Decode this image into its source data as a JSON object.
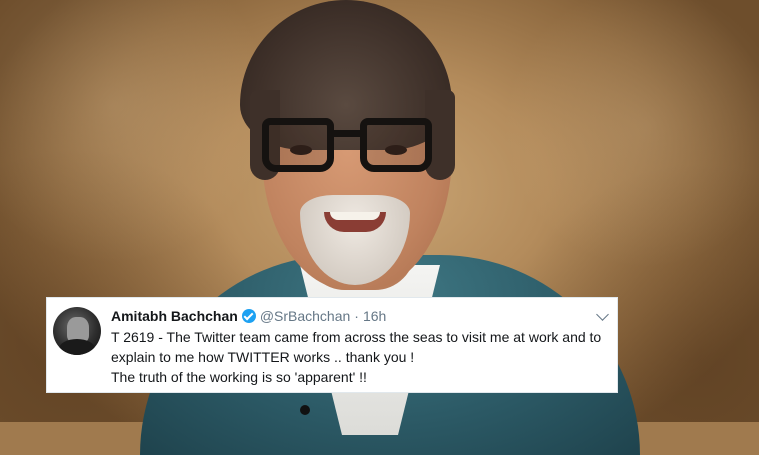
{
  "tweet": {
    "display_name": "Amitabh Bachchan",
    "handle": "@SrBachchan",
    "separator": "·",
    "time": "16h",
    "lines": [
      "T 2619 - The Twitter team came from across the seas to visit me at work and to",
      "explain to me how TWITTER works .. thank you !",
      "The truth of the working is so 'apparent' !!"
    ],
    "verified": true
  },
  "icons": {
    "verified": "verified-badge-icon",
    "menu": "chevron-down-icon"
  },
  "colors": {
    "verified_blue": "#1da1f2",
    "secondary_text": "#657786",
    "primary_text": "#14171a",
    "jacket": "#2c5a66"
  }
}
